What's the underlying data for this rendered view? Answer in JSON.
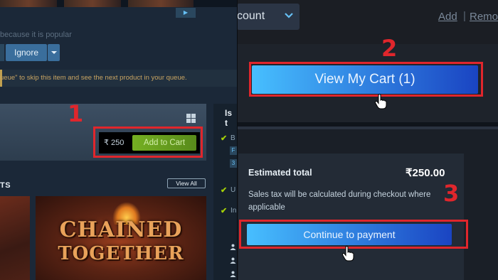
{
  "left": {
    "popular_text": "because it is popular",
    "ignore_label": "Ignore",
    "queue_text": "ueue\" to skip this item and see the next product in your queue.",
    "price": "₹ 250",
    "add_to_cart_label": "Add to Cart",
    "step1": "1",
    "section_label": "TS",
    "view_all_label": "View All",
    "card_title_line1": "CHAINED",
    "card_title_line2": "TOGETHER",
    "side_label": "Is t",
    "side_letters": [
      "B",
      "F",
      "3",
      "U",
      "In"
    ]
  },
  "top_right": {
    "account_text": "count",
    "add_link": "Add",
    "separator": "|",
    "remove_link": "Remo",
    "step2": "2",
    "view_cart_label": "View My Cart (1)"
  },
  "bottom_right": {
    "estimated_total_label": "Estimated total",
    "estimated_total_value": "₹250.00",
    "tax_note": "Sales tax will be calculated during checkout where applicable",
    "step3": "3",
    "continue_label": "Continue to payment"
  },
  "colors": {
    "annotation_red": "#e0262c",
    "steam_blue": "#47bfff",
    "add_to_cart_green": "#75b022"
  }
}
